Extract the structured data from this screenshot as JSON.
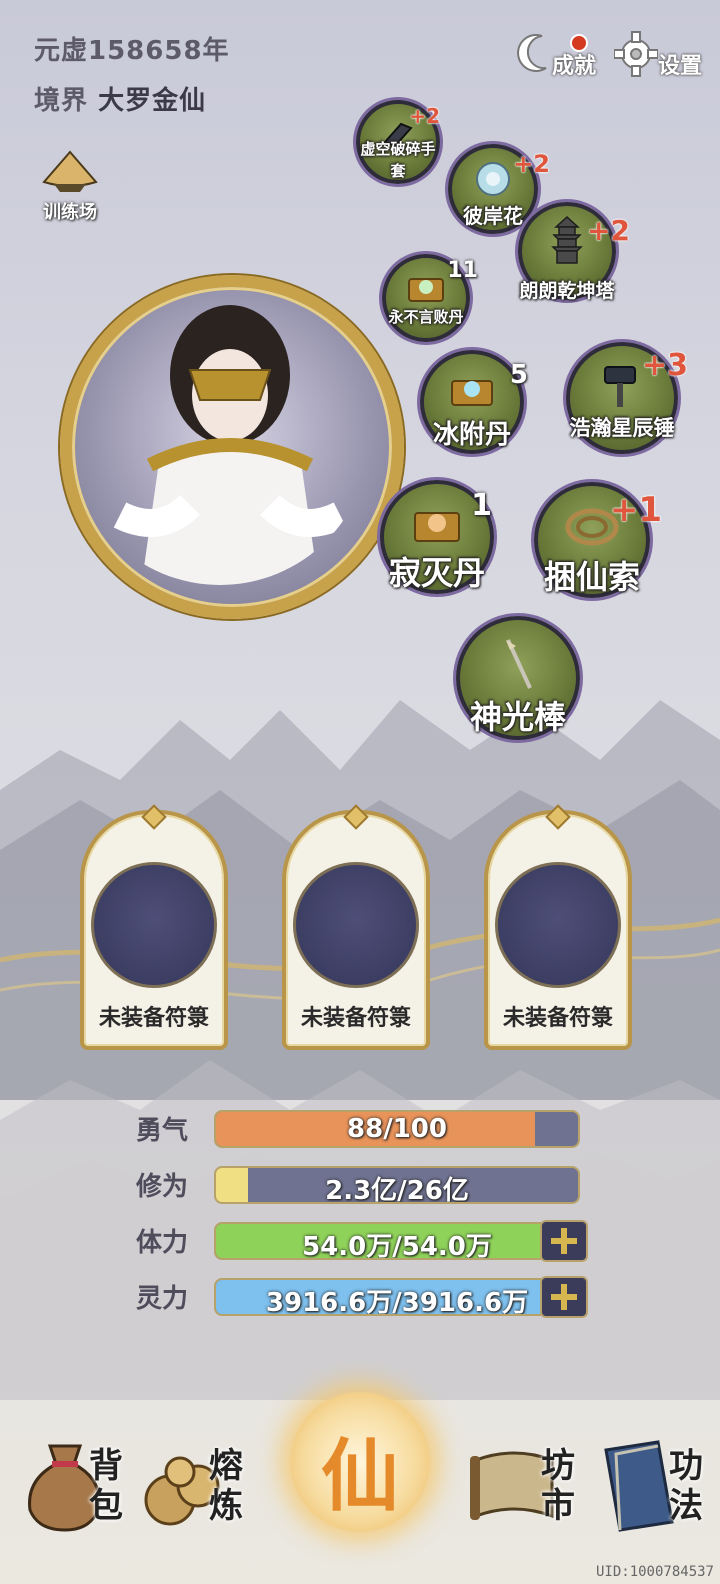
{
  "header": {
    "era_label": "元虚158658年",
    "realm_label": "境界",
    "realm_value": "大罗金仙"
  },
  "top_buttons": {
    "achievements": "成就",
    "settings": "设置"
  },
  "training_ground": {
    "label": "训练场"
  },
  "items": [
    {
      "name": "虚空破碎手套",
      "bonus": "+2",
      "count": ""
    },
    {
      "name": "彼岸花",
      "bonus": "+2",
      "count": ""
    },
    {
      "name": "朗朗乾坤塔",
      "bonus": "+2",
      "count": ""
    },
    {
      "name": "永不言败丹",
      "bonus": "",
      "count": "11"
    },
    {
      "name": "冰附丹",
      "bonus": "",
      "count": "5"
    },
    {
      "name": "浩瀚星辰锤",
      "bonus": "+3",
      "count": ""
    },
    {
      "name": "寂灭丹",
      "bonus": "",
      "count": "1"
    },
    {
      "name": "捆仙索",
      "bonus": "+1",
      "count": ""
    },
    {
      "name": "神光棒",
      "bonus": "",
      "count": ""
    }
  ],
  "talismans": [
    {
      "label": "未装备符箓"
    },
    {
      "label": "未装备符箓"
    },
    {
      "label": "未装备符箓"
    }
  ],
  "stats": [
    {
      "label": "勇气",
      "value": "88/100",
      "fraction": 0.88,
      "color": "#e8935a"
    },
    {
      "label": "修为",
      "value": "2.3亿/26亿",
      "fraction": 0.088,
      "color": "#f1df84"
    },
    {
      "label": "体力",
      "value": "54.0万/54.0万",
      "fraction": 1.0,
      "color": "#8fd25a"
    },
    {
      "label": "灵力",
      "value": "3916.6万/3916.6万",
      "fraction": 1.0,
      "color": "#7ec0ee"
    }
  ],
  "nav": {
    "bag": "背包",
    "smelt": "熔炼",
    "center": "仙",
    "market": "坊市",
    "skills": "功法"
  },
  "uid": "UID:1000784537"
}
